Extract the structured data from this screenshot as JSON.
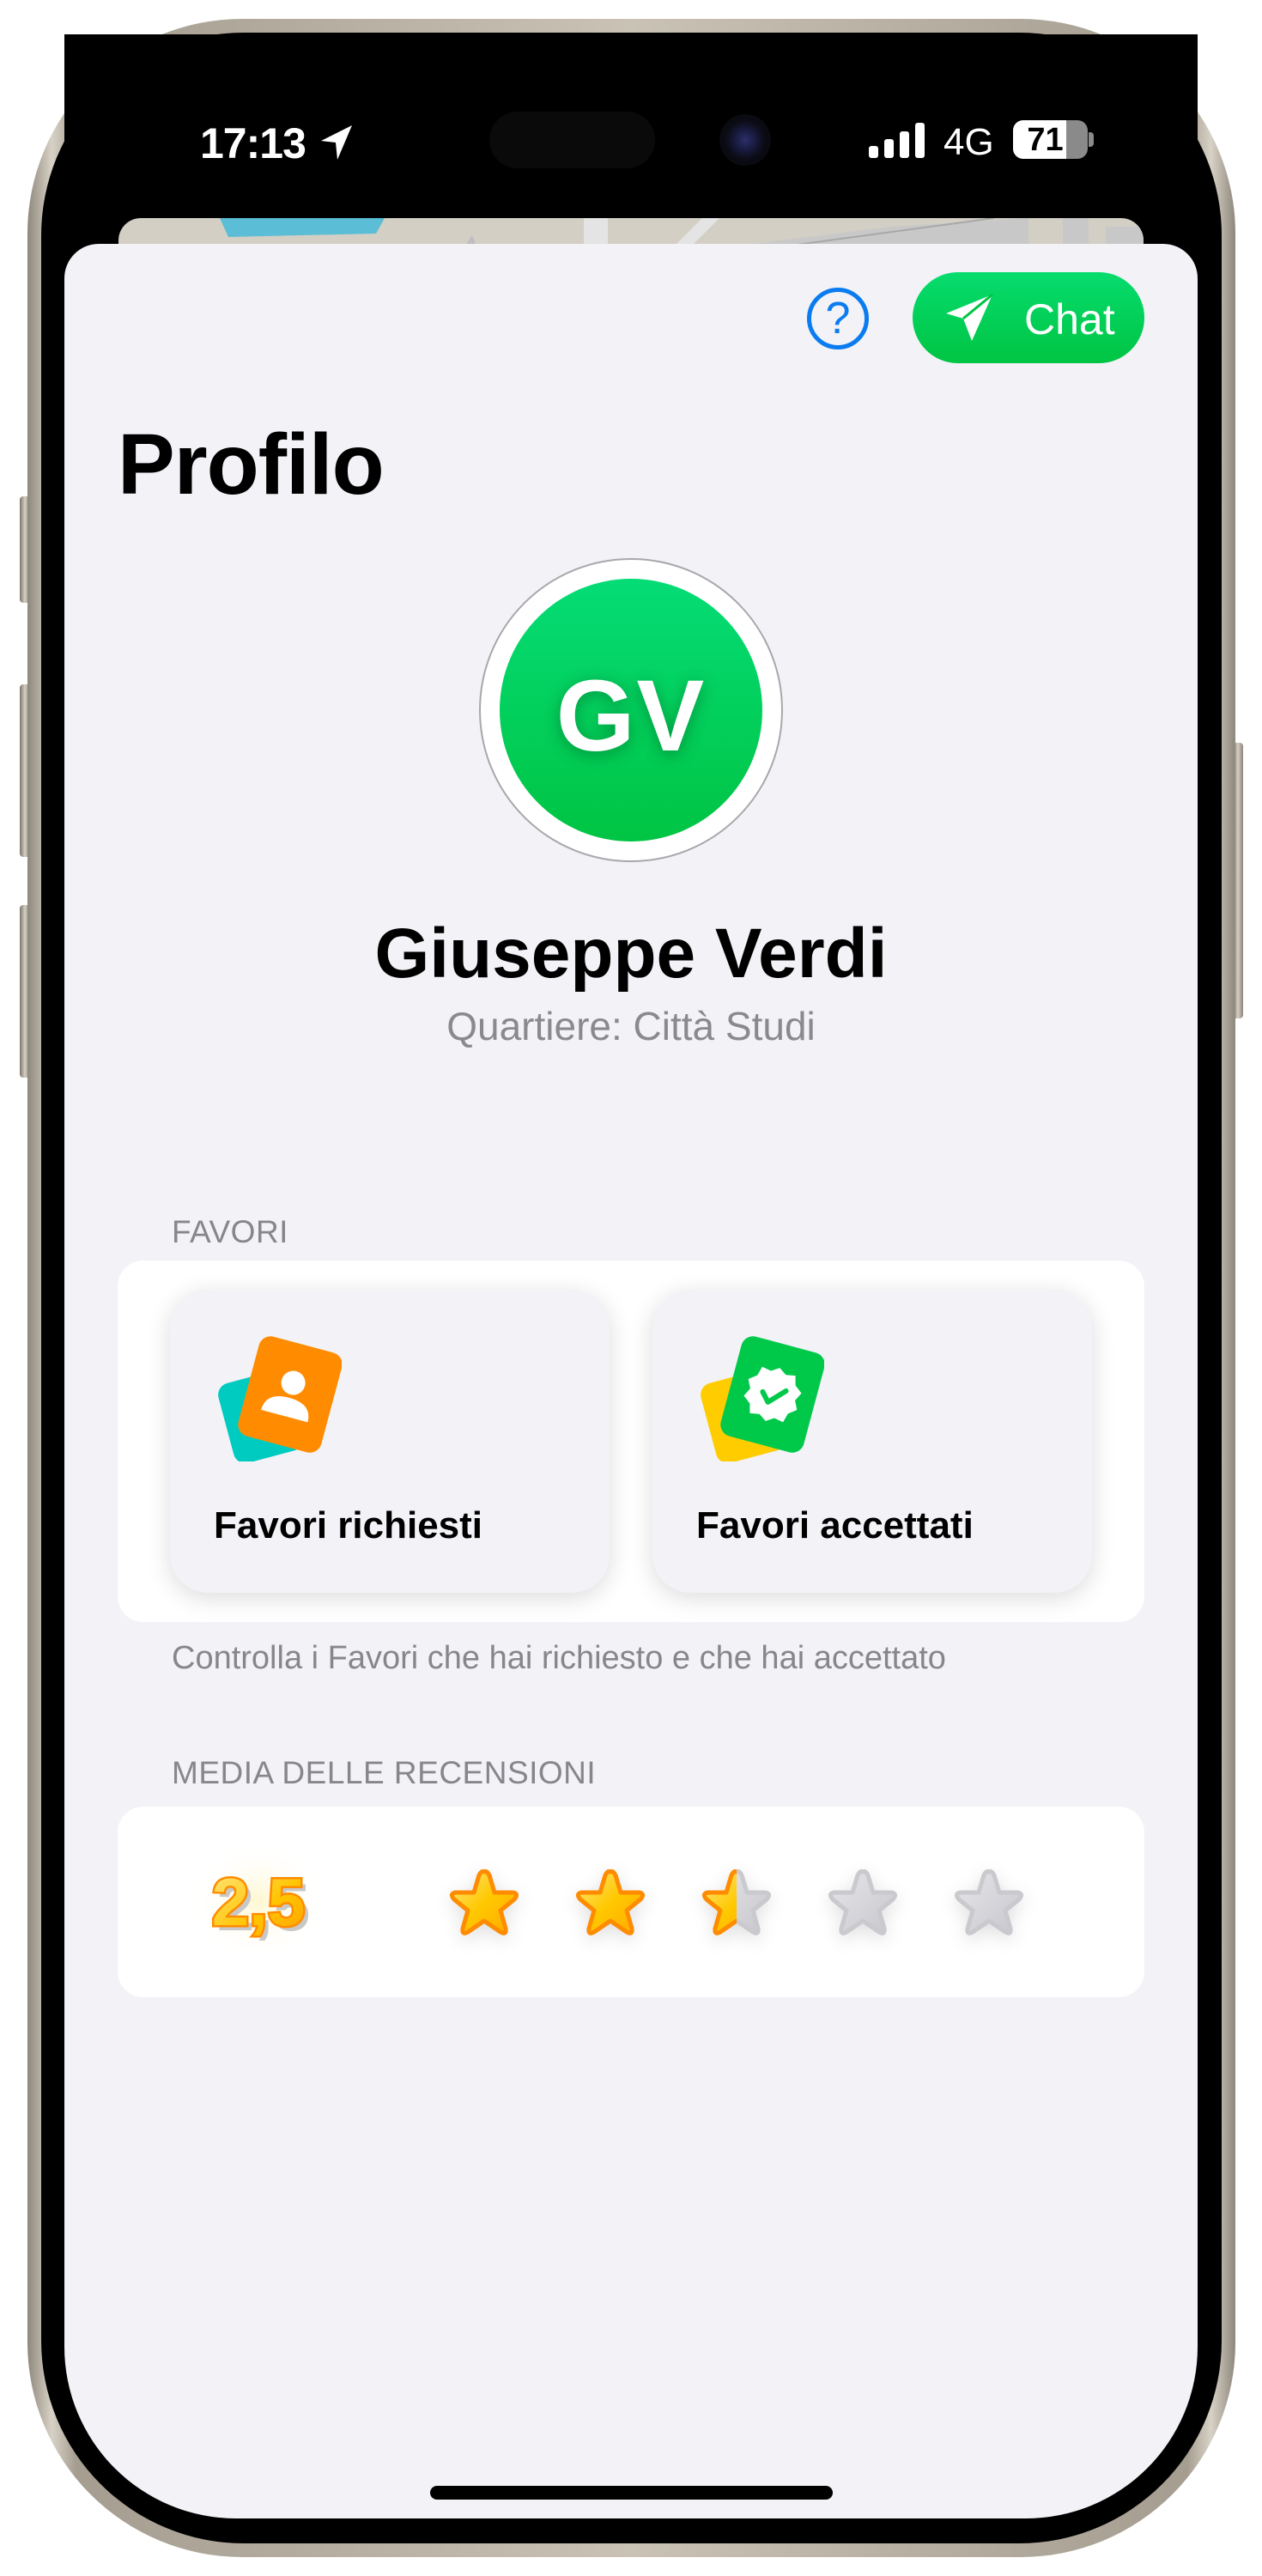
{
  "status_bar": {
    "time": "17:13",
    "network": "4G",
    "battery_percent": 71,
    "battery_label": "71",
    "signal_bars": 4
  },
  "header": {
    "help_icon": "question-circle-icon",
    "help_glyph": "?",
    "chat_label": "Chat",
    "chat_icon": "paper-plane-icon"
  },
  "page": {
    "title": "Profilo"
  },
  "profile": {
    "initials": "GV",
    "name": "Giuseppe Verdi",
    "neighborhood": "Quartiere: Città Studi",
    "avatar_color": "#00c853"
  },
  "favors": {
    "section_label": "FAVORI",
    "cards": [
      {
        "label": "Favori richiesti",
        "icon": "person-card-icon",
        "colors": {
          "back": "#00cbc0",
          "front": "#ff8c00"
        }
      },
      {
        "label": "Favori accettati",
        "icon": "verified-badge-card-icon",
        "colors": {
          "back": "#ffcc00",
          "front": "#00c94a"
        }
      }
    ],
    "caption": "Controlla i Favori che hai richiesto e che hai accettato"
  },
  "reviews": {
    "section_label": "MEDIA DELLE RECENSIONI",
    "average_label": "2,5",
    "average": 2.5,
    "max_stars": 5
  },
  "colors": {
    "accent_green": "#00c443",
    "accent_blue": "#0a7cf0",
    "background": "#f2f2f7",
    "star_fill": "#ffc800",
    "star_outline": "#ff8c00",
    "star_empty": "#c9c9ce"
  }
}
